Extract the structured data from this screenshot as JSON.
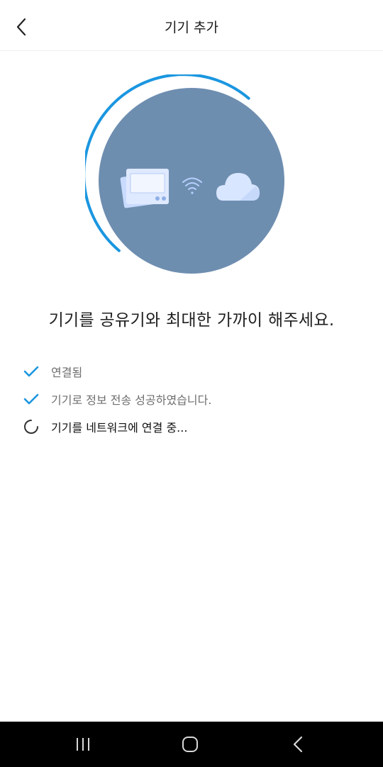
{
  "header": {
    "back_icon": "chevron-left-icon",
    "title": "기기 추가"
  },
  "illustration": {
    "device_icon": "thermostat-device-icon",
    "wifi_icon": "wifi-icon",
    "cloud_icon": "cloud-icon",
    "progress_fraction": 0.38,
    "colors": {
      "circle": "#6e8eb0",
      "arc": "#1a96e0",
      "device": "#dfe9ff",
      "cloud": "#d8e6ff"
    }
  },
  "headline": "기기를 공유기와 최대한 가까이 해주세요.",
  "steps": [
    {
      "status": "done",
      "icon": "checkmark-icon",
      "text": "연결됨"
    },
    {
      "status": "done",
      "icon": "checkmark-icon",
      "text": "기기로 정보 전송 성공하였습니다."
    },
    {
      "status": "in-progress",
      "icon": "loading-spinner-icon",
      "text": "기기를 네트워크에 연결 중..."
    }
  ],
  "colors": {
    "accent": "#1a96e0",
    "done_text": "#6e6e6e",
    "active_text": "#111111"
  },
  "navbar": {
    "recent_icon": "recent-apps-icon",
    "home_icon": "home-icon",
    "back_icon": "back-icon"
  }
}
